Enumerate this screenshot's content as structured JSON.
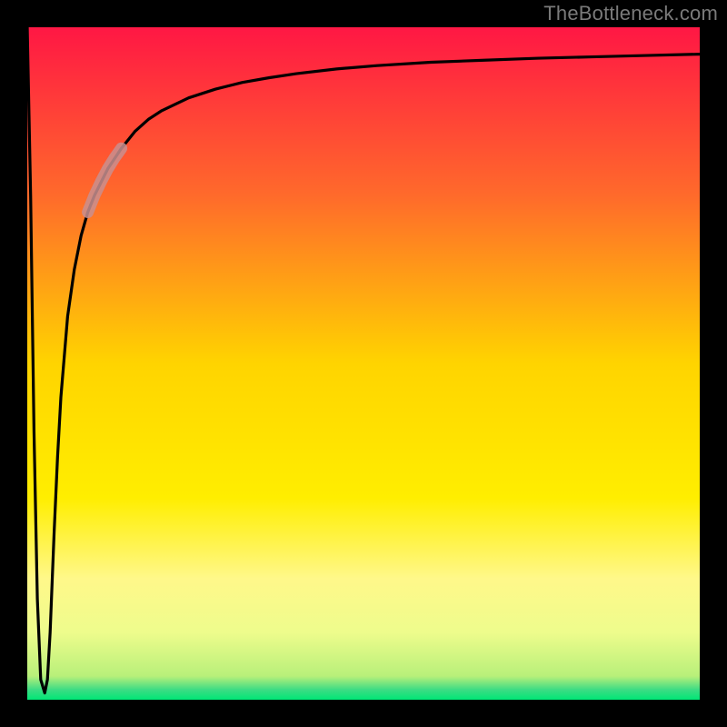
{
  "watermark": "TheBottleneck.com",
  "chart_data": {
    "type": "line",
    "title": "",
    "xlabel": "",
    "ylabel": "",
    "xlim": [
      0,
      100
    ],
    "ylim": [
      0,
      100
    ],
    "grid": false,
    "legend": false,
    "background_gradient_stops": [
      {
        "offset": 0.0,
        "color": "#ff1744"
      },
      {
        "offset": 0.25,
        "color": "#ff6a2b"
      },
      {
        "offset": 0.5,
        "color": "#ffd400"
      },
      {
        "offset": 0.7,
        "color": "#ffee00"
      },
      {
        "offset": 0.82,
        "color": "#fff88a"
      },
      {
        "offset": 0.9,
        "color": "#eefc8c"
      },
      {
        "offset": 0.965,
        "color": "#b8f07a"
      },
      {
        "offset": 0.985,
        "color": "#3ddc84"
      },
      {
        "offset": 1.0,
        "color": "#00e676"
      }
    ],
    "series": [
      {
        "name": "curve",
        "color": "#000000",
        "x": [
          0.0,
          0.5,
          1.0,
          1.5,
          2.0,
          2.6,
          3.0,
          3.4,
          4.0,
          4.5,
          5.0,
          6.0,
          7.0,
          8.0,
          9.0,
          10.0,
          12.0,
          14.0,
          16.0,
          18.0,
          20.0,
          24.0,
          28.0,
          32.0,
          36.0,
          40.0,
          46.0,
          52.0,
          60.0,
          68.0,
          76.0,
          84.0,
          92.0,
          100.0
        ],
        "y": [
          100.0,
          75.0,
          40.0,
          15.0,
          3.0,
          1.0,
          3.0,
          10.0,
          25.0,
          36.0,
          45.0,
          57.0,
          64.0,
          69.0,
          72.5,
          75.0,
          79.0,
          82.0,
          84.5,
          86.3,
          87.6,
          89.5,
          90.8,
          91.8,
          92.5,
          93.1,
          93.8,
          94.3,
          94.8,
          95.1,
          95.4,
          95.6,
          95.8,
          96.0
        ]
      },
      {
        "name": "highlight-segment",
        "color": "#c98f8f",
        "opacity": 0.85,
        "width": 13,
        "x": [
          9.0,
          10.0,
          11.0,
          12.0,
          13.0,
          14.0
        ],
        "y": [
          72.5,
          75.0,
          77.1,
          79.0,
          80.6,
          82.0
        ]
      }
    ]
  }
}
